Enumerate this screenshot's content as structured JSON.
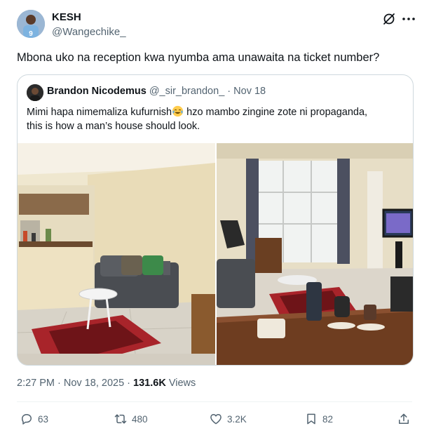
{
  "author": {
    "name": "KESH",
    "handle": "@Wangechike_"
  },
  "tweet": {
    "text": "Mbona uko na reception kwa nyumba ama unawaita na ticket number?"
  },
  "quoted": {
    "name": "Brandon Nicodemus",
    "handle": "@_sir_brandon_",
    "dot": "·",
    "date": "Nov 18",
    "text_part1": "Mimi hapa nimemaliza kufurnish",
    "emoji": "face-with-tears-of-joy",
    "text_part2": " hzo mambo zingine zote ni propaganda,",
    "text_line2": "this is how a man’s house should look."
  },
  "meta": {
    "time": "2:27 PM · Nov 18, 2025 · ",
    "views_count": "131.6K",
    "views_label": " Views"
  },
  "actions": {
    "replies": "63",
    "reposts": "480",
    "likes": "3.2K",
    "bookmarks": "82"
  },
  "icons": [
    "grok-icon",
    "more-icon",
    "reply-icon",
    "repost-icon",
    "like-icon",
    "bookmark-icon",
    "share-icon"
  ],
  "colors": {
    "text": "#0f1419",
    "secondary": "#536471",
    "border": "#cfd9de"
  }
}
